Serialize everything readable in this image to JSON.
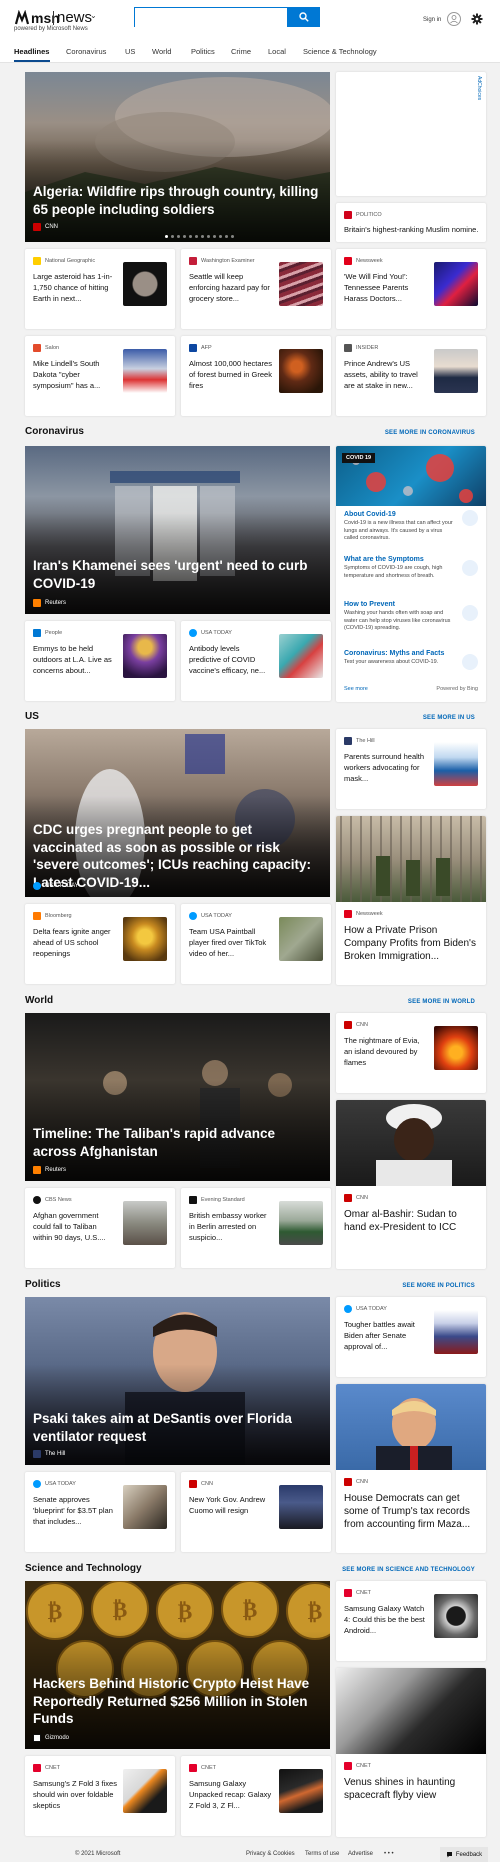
{
  "header": {
    "brand": "msn",
    "product": "news",
    "chevron": "⌄",
    "powered_by": "powered by Microsoft News",
    "search_value": "",
    "search_placeholder": "",
    "sign_in": "Sign in",
    "colors": {
      "accent": "#0078d4"
    }
  },
  "nav": {
    "items": [
      "Headlines",
      "Coronavirus",
      "US",
      "World",
      "Politics",
      "Crime",
      "Local",
      "Science & Technology"
    ],
    "active": "Headlines"
  },
  "top": {
    "hero": {
      "title": "Algeria: Wildfire rips through country, killing 65 people including soldiers",
      "source": "CNN"
    },
    "ad_label": "AdChoices",
    "side_card": {
      "source": "POLITICO",
      "title": "Britain's highest-ranking Muslim nomine..."
    },
    "cards": [
      {
        "source": "National Geographic",
        "title": "Large asteroid has 1-in-1,750 chance of hitting Earth in next..."
      },
      {
        "source": "Washington Examiner",
        "title": "Seattle will keep enforcing hazard pay for grocery store..."
      },
      {
        "source": "Newsweek",
        "title": "'We Will Find You!': Tennessee Parents Harass Doctors..."
      },
      {
        "source": "Salon",
        "title": "Mike Lindell's South Dakota \"cyber symposium\" has a..."
      },
      {
        "source": "AFP",
        "title": "Almost 100,000 hectares of forest burned in Greek fires"
      },
      {
        "source": "INSIDER",
        "title": "Prince Andrew's US assets, ability to travel are at stake in new..."
      }
    ]
  },
  "coronavirus": {
    "title": "Coronavirus",
    "see_more": "SEE MORE IN CORONAVIRUS",
    "hero": {
      "title": "Iran's Khamenei sees 'urgent' need to curb COVID-19",
      "source": "Reuters"
    },
    "cards": [
      {
        "source": "People",
        "title": "Emmys to be held outdoors at L.A. Live as concerns about..."
      },
      {
        "source": "USA TODAY",
        "title": "Antibody levels predictive of COVID vaccine's efficacy, ne..."
      }
    ],
    "panel": {
      "tag": "COVID 19",
      "items": [
        {
          "heading": "About Covid-19",
          "desc": "Covid-19 is a new illness that can affect your lungs and airways. It's caused by a virus called coronavirus."
        },
        {
          "heading": "What are the Symptoms",
          "desc": "Symptoms of COVID-19 are cough, high temperature and shortness of breath."
        },
        {
          "heading": "How to Prevent",
          "desc": "Washing your hands often with soap and water can help stop viruses like coronavirus (COVID-19) spreading."
        },
        {
          "heading": "Coronavirus: Myths and Facts",
          "desc": "Test your awareness about COVID-19."
        }
      ],
      "see_more": "See more",
      "powered": "Powered by Bing"
    }
  },
  "us": {
    "title": "US",
    "see_more": "SEE MORE IN US",
    "hero": {
      "title": "CDC urges pregnant people to get vaccinated as soon as possible or risk 'severe outcomes'; ICUs reaching capacity: Latest COVID-19...",
      "source": "USA TODAY"
    },
    "side_card": {
      "source": "The Hill",
      "title": "Parents surround health workers advocating for mask..."
    },
    "big_card": {
      "source": "Newsweek",
      "title": "How a Private Prison Company Profits from Biden's Broken Immigration..."
    },
    "cards": [
      {
        "source": "Bloomberg",
        "title": "Delta fears ignite anger ahead of US school reopenings"
      },
      {
        "source": "USA TODAY",
        "title": "Team USA Paintball player fired over TikTok video of her..."
      }
    ]
  },
  "world": {
    "title": "World",
    "see_more": "SEE MORE IN WORLD",
    "hero": {
      "title": "Timeline: The Taliban's rapid advance across Afghanistan",
      "source": "Reuters"
    },
    "side_card": {
      "source": "CNN",
      "title": "The nightmare of Evia, an island devoured by flames"
    },
    "big_card": {
      "source": "CNN",
      "title": "Omar al-Bashir: Sudan to hand ex-President to ICC"
    },
    "cards": [
      {
        "source": "CBS News",
        "title": "Afghan government could fall to Taliban within 90 days, U.S...."
      },
      {
        "source": "Evening Standard",
        "title": "British embassy worker in Berlin arrested on suspicio..."
      }
    ]
  },
  "politics": {
    "title": "Politics",
    "see_more": "SEE MORE IN POLITICS",
    "hero": {
      "title": "Psaki takes aim at DeSantis over Florida ventilator request",
      "source": "The Hill"
    },
    "side_card": {
      "source": "USA TODAY",
      "title": "Tougher battles await Biden after Senate approval of..."
    },
    "big_card": {
      "source": "CNN",
      "title": "House Democrats can get some of Trump's tax records from accounting firm Maza..."
    },
    "cards": [
      {
        "source": "USA TODAY",
        "title": "Senate approves 'blueprint' for $3.5T plan that includes..."
      },
      {
        "source": "CNN",
        "title": "New York Gov. Andrew Cuomo will resign"
      }
    ]
  },
  "scitech": {
    "title": "Science and Technology",
    "see_more": "SEE MORE IN SCIENCE AND TECHNOLOGY",
    "hero": {
      "title": "Hackers Behind Historic Crypto Heist Have Reportedly Returned $256 Million in Stolen Funds",
      "source": "Gizmodo"
    },
    "side_card": {
      "source": "CNET",
      "title": "Samsung Galaxy Watch 4: Could this be the best Android..."
    },
    "big_card": {
      "source": "CNET",
      "title": "Venus shines in haunting spacecraft flyby view"
    },
    "cards": [
      {
        "source": "CNET",
        "title": "Samsung's Z Fold 3 fixes should win over foldable skeptics"
      },
      {
        "source": "CNET",
        "title": "Samsung Galaxy Unpacked recap: Galaxy Z Fold 3, Z Fl..."
      }
    ]
  },
  "footer": {
    "copyright": "© 2021 Microsoft",
    "privacy": "Privacy & Cookies",
    "terms": "Terms of use",
    "advertise": "Advertise",
    "more": "• • •",
    "feedback": "Feedback"
  }
}
